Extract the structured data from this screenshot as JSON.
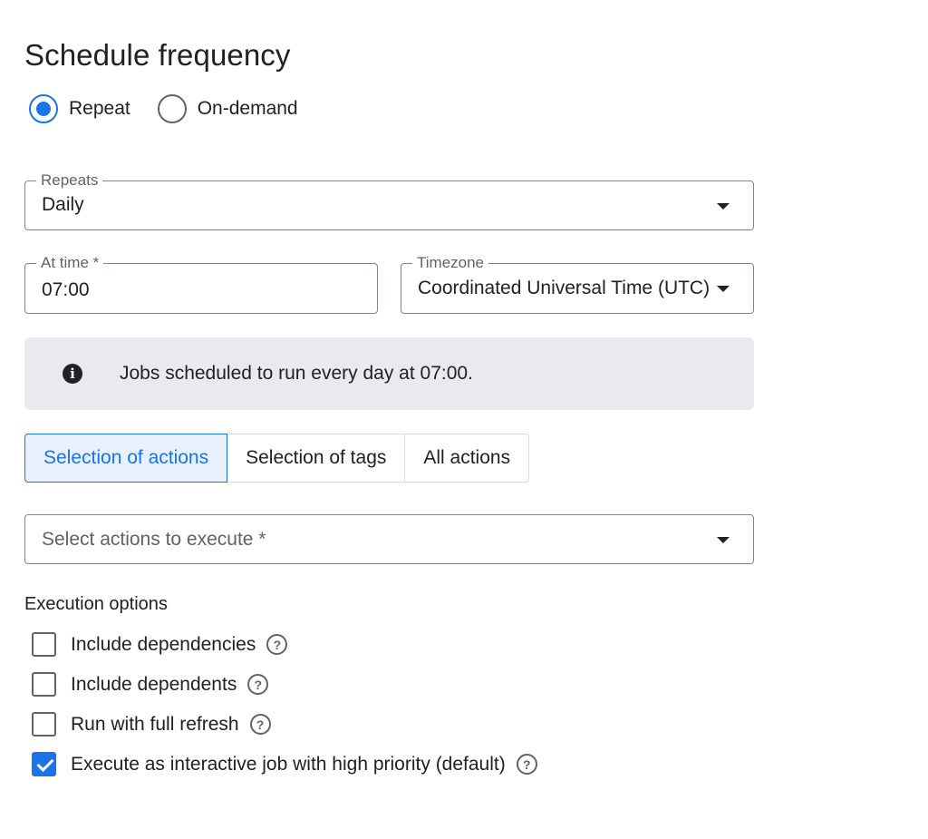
{
  "title": "Schedule frequency",
  "frequency": {
    "options": [
      {
        "label": "Repeat",
        "selected": true
      },
      {
        "label": "On-demand",
        "selected": false
      }
    ]
  },
  "repeats": {
    "label": "Repeats",
    "value": "Daily"
  },
  "at_time": {
    "label": "At time *",
    "value": "07:00"
  },
  "timezone": {
    "label": "Timezone",
    "value": "Coordinated Universal Time (UTC)"
  },
  "info": {
    "text": "Jobs scheduled to run every day at 07:00."
  },
  "action_tabs": [
    {
      "label": "Selection of actions",
      "active": true
    },
    {
      "label": "Selection of tags",
      "active": false
    },
    {
      "label": "All actions",
      "active": false
    }
  ],
  "actions_select": {
    "placeholder": "Select actions to execute *"
  },
  "execution": {
    "title": "Execution options",
    "options": [
      {
        "label": "Include dependencies",
        "checked": false
      },
      {
        "label": "Include dependents",
        "checked": false
      },
      {
        "label": "Run with full refresh",
        "checked": false
      },
      {
        "label": "Execute as interactive job with high priority (default)",
        "checked": true
      }
    ]
  },
  "colors": {
    "accent": "#1a73e8",
    "info_bg": "#e8eaed",
    "border": "#80868b"
  }
}
